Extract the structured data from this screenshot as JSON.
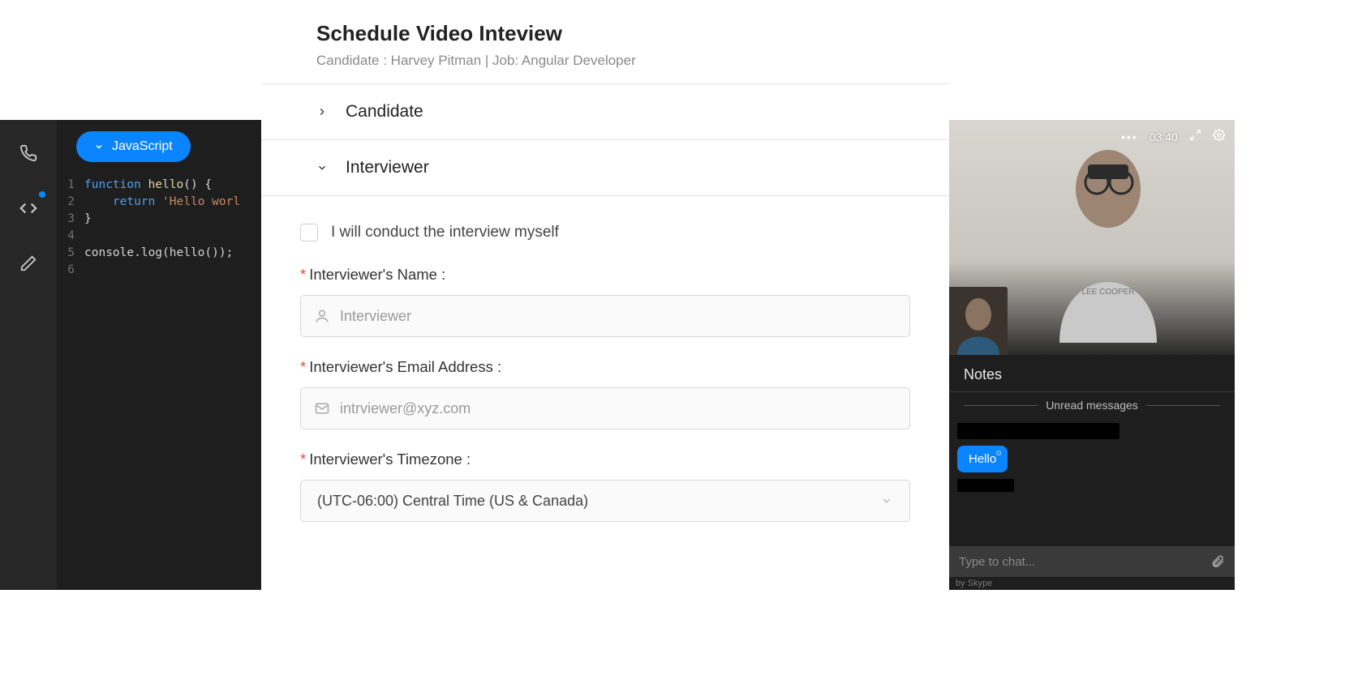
{
  "editor": {
    "language": "JavaScript",
    "code_lines": [
      {
        "n": 1,
        "raw": "function hello() {",
        "kw": "function",
        "fn": "hello",
        "tail": "() {"
      },
      {
        "n": 2,
        "raw": "    return 'Hello worl",
        "indent": "    ",
        "kw": "return",
        "str": "'Hello worl"
      },
      {
        "n": 3,
        "raw": "}",
        "plain": "}"
      },
      {
        "n": 4,
        "raw": "",
        "plain": ""
      },
      {
        "n": 5,
        "raw": "console.log(hello());",
        "plain": "console.log(hello());"
      },
      {
        "n": 6,
        "raw": "",
        "plain": ""
      }
    ]
  },
  "form": {
    "title": "Schedule Video Inteview",
    "subtitle": "Candidate : Harvey Pitman | Job: Angular Developer",
    "sections": {
      "candidate_label": "Candidate",
      "interviewer_label": "Interviewer"
    },
    "self_conduct_label": "I will conduct the interview myself",
    "fields": {
      "name_label": "Interviewer's Name :",
      "name_placeholder": "Interviewer",
      "email_label": "Interviewer's Email Address :",
      "email_placeholder": "intrviewer@xyz.com",
      "tz_label": "Interviewer's Timezone :",
      "tz_value": "(UTC-06:00) Central Time (US & Canada)"
    }
  },
  "video": {
    "timer": "03:40",
    "notes_label": "Notes",
    "unread_label": "Unread messages",
    "message": "Hello",
    "chat_placeholder": "Type to chat...",
    "powered": "by Skype"
  }
}
